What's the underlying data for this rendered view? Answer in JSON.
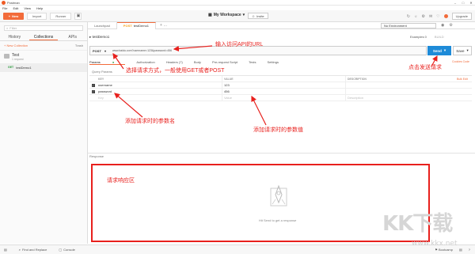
{
  "window": {
    "title": "Postman"
  },
  "menu": [
    "File",
    "Edit",
    "View",
    "Help"
  ],
  "toolbar": {
    "new_label": "New",
    "import_label": "Import",
    "runner_label": "Runner",
    "workspace_label": "My Workspace",
    "invite_label": "Invite",
    "upgrade_label": "Upgrade"
  },
  "sidebar": {
    "filter_placeholder": "Filter",
    "tabs": [
      "History",
      "Collections",
      "APIs"
    ],
    "new_collection": "+ New Collection",
    "trash": "Trash",
    "collection": {
      "name": "Test",
      "sub": "1 request"
    },
    "request": {
      "method": "GET",
      "name": "testDemo1"
    }
  },
  "request_tabs": [
    {
      "method": "",
      "label": "Launchpad"
    },
    {
      "method": "POST",
      "label": "testDemo1"
    }
  ],
  "environment": "No Environment",
  "request": {
    "name": "testDemo1",
    "examples": "Examples 0",
    "build": "BUILD",
    "method": "POST",
    "url": "www.baidu.com?username=123&password=456",
    "send_label": "Send",
    "save_label": "Save",
    "subtabs": [
      "Params",
      "Authorization",
      "Headers (7)",
      "Body",
      "Pre-request Script",
      "Tests",
      "Settings"
    ],
    "cookies": "Cookies  Code",
    "query_params_label": "Query Params",
    "bulk_edit": "Bulk Edit",
    "table_headers": [
      "KEY",
      "VALUE",
      "DESCRIPTION"
    ],
    "params": [
      {
        "key": "username",
        "value": "123",
        "description": "",
        "checked": true
      },
      {
        "key": "password",
        "value": "456",
        "description": "",
        "checked": true
      }
    ],
    "placeholder_row": {
      "key": "Key",
      "value": "Value",
      "description": "Description"
    }
  },
  "response": {
    "label": "Response",
    "hint": "Hit Send to get a response"
  },
  "statusbar": {
    "find_replace": "Find and Replace",
    "console": "Console",
    "bootcamp": "Bootcamp"
  },
  "annotations": {
    "url": "输入访问API的URL",
    "method": "选择请求方式，一般使用GET或者POST",
    "send": "点击发送请求",
    "param_name": "添加请求时的参数名",
    "param_value": "添加请求时的参数值",
    "response_area": "请求响应区"
  },
  "watermark": {
    "main": "KK下载",
    "url": "www.kkx.net"
  },
  "colors": {
    "accent": "#f26b3a",
    "send": "#1e8bd8",
    "annotation": "#e8201d"
  }
}
